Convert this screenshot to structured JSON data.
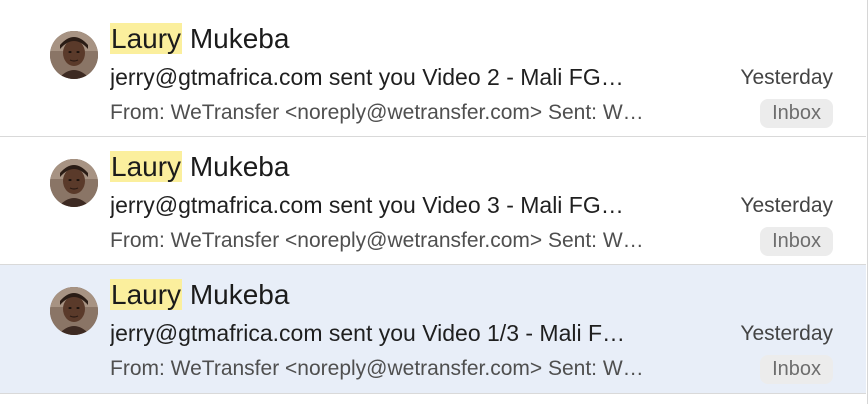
{
  "colors": {
    "highlight": "#fbef9d",
    "selected_row": "#e8eef8",
    "badge_bg": "#ececec"
  },
  "messages": [
    {
      "avatar_icon": "contact-photo",
      "sender_highlight": "Laury",
      "sender_rest": " Mukeba",
      "subject": "jerry@gtmafrica.com sent you Video 2 - Mali FG…",
      "date": "Yesterday",
      "preview": "From: WeTransfer <noreply@wetransfer.com> Sent: W…",
      "mailbox": "Inbox",
      "selected": false
    },
    {
      "avatar_icon": "contact-photo",
      "sender_highlight": "Laury",
      "sender_rest": " Mukeba",
      "subject": "jerry@gtmafrica.com sent you Video 3 - Mali FG…",
      "date": "Yesterday",
      "preview": "From: WeTransfer <noreply@wetransfer.com> Sent: W…",
      "mailbox": "Inbox",
      "selected": false
    },
    {
      "avatar_icon": "contact-photo",
      "sender_highlight": "Laury",
      "sender_rest": " Mukeba",
      "subject": "jerry@gtmafrica.com sent you Video 1/3 - Mali F…",
      "date": "Yesterday",
      "preview": "From: WeTransfer <noreply@wetransfer.com> Sent: W…",
      "mailbox": "Inbox",
      "selected": true
    }
  ]
}
